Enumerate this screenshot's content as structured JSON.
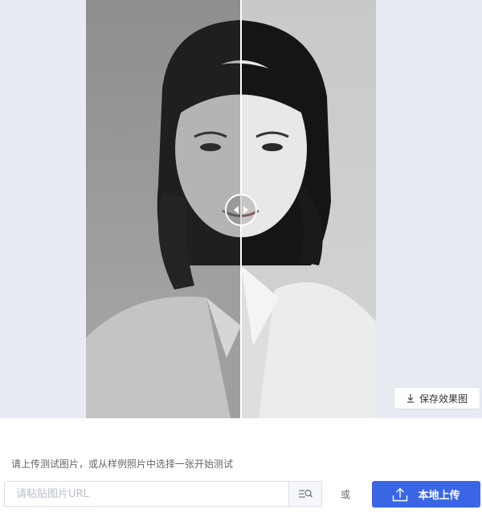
{
  "preview": {
    "photo_description_icon": "portrait-photo",
    "handle_icon": "left-right-arrows-icon"
  },
  "actions": {
    "save_label": "保存效果图",
    "save_icon": "download-icon"
  },
  "upload": {
    "hint": "请上传测试图片，或从样例照片中选择一张开始测试",
    "url_placeholder": "请粘贴图片URL",
    "url_search_icon": "image-search-icon",
    "or_label": "或",
    "upload_label": "本地上传",
    "upload_icon": "upload-icon"
  },
  "colors": {
    "accent": "#3a66e6",
    "stage_bg": "#e8ebf2"
  }
}
